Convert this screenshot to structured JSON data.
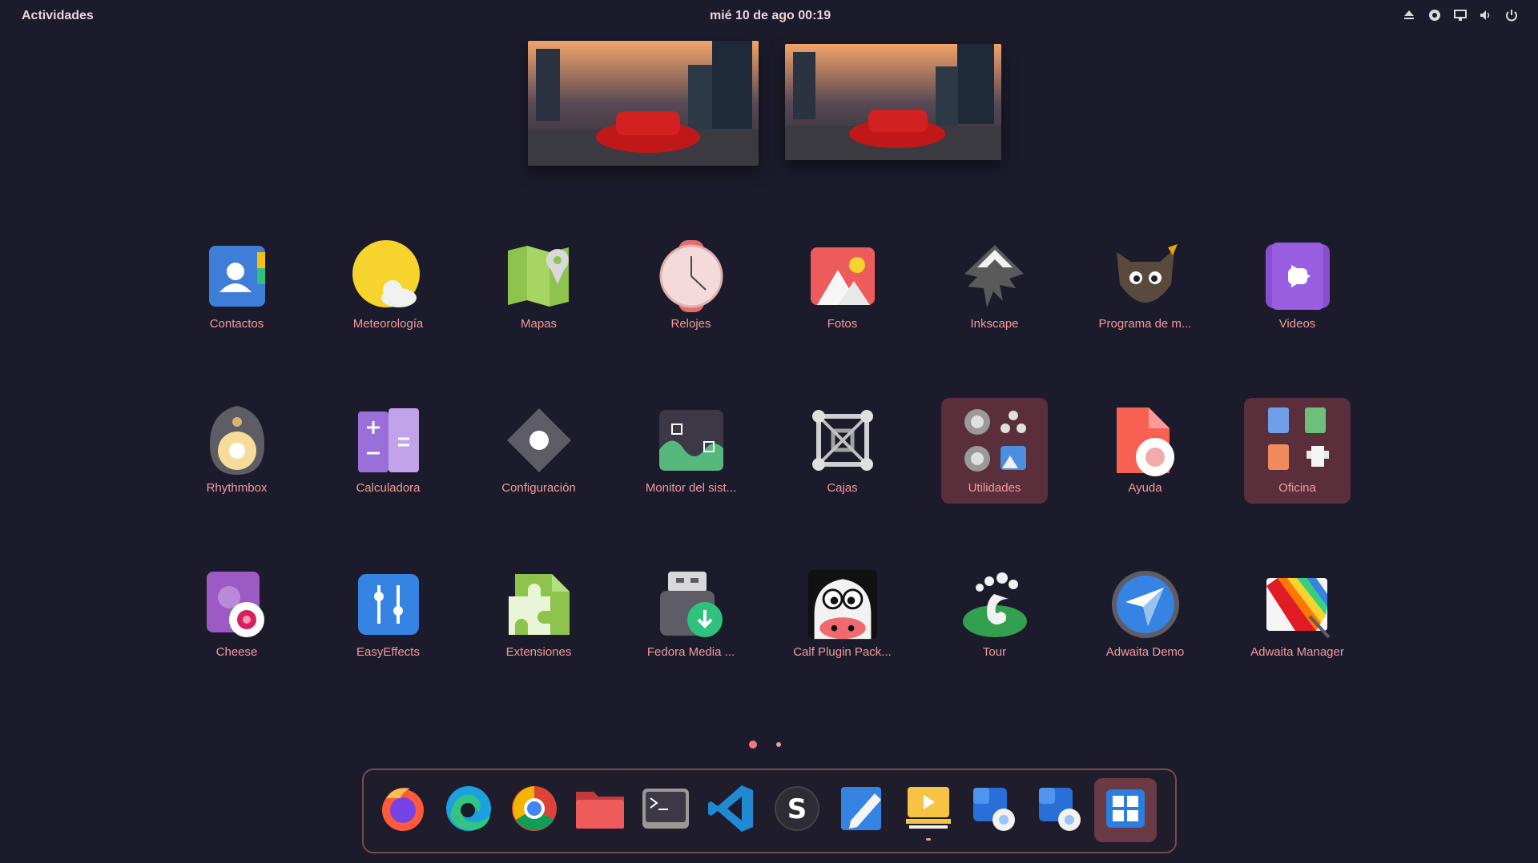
{
  "topbar": {
    "activities": "Actividades",
    "clock": "mié 10 de ago  00:19"
  },
  "tray_icons": [
    "eject-icon",
    "camera-icon",
    "network-icon",
    "volume-icon",
    "power-icon"
  ],
  "apps": [
    {
      "label": "Contactos",
      "icon": "contacts-icon"
    },
    {
      "label": "Meteorología",
      "icon": "weather-icon"
    },
    {
      "label": "Mapas",
      "icon": "maps-icon"
    },
    {
      "label": "Relojes",
      "icon": "clocks-icon"
    },
    {
      "label": "Fotos",
      "icon": "photos-icon"
    },
    {
      "label": "Inkscape",
      "icon": "inkscape-icon"
    },
    {
      "label": "Programa de m...",
      "icon": "gimp-icon"
    },
    {
      "label": "Videos",
      "icon": "videos-icon"
    },
    {
      "label": "Rhythmbox",
      "icon": "rhythmbox-icon"
    },
    {
      "label": "Calculadora",
      "icon": "calculator-icon"
    },
    {
      "label": "Configuración",
      "icon": "settings-icon"
    },
    {
      "label": "Monitor del sist...",
      "icon": "system-monitor-icon"
    },
    {
      "label": "Cajas",
      "icon": "boxes-icon"
    },
    {
      "label": "Utilidades",
      "icon": "utilities-folder-icon"
    },
    {
      "label": "Ayuda",
      "icon": "help-icon"
    },
    {
      "label": "Oficina",
      "icon": "office-folder-icon"
    },
    {
      "label": "Cheese",
      "icon": "cheese-icon"
    },
    {
      "label": "EasyEffects",
      "icon": "easyeffects-icon"
    },
    {
      "label": "Extensiones",
      "icon": "extensions-icon"
    },
    {
      "label": "Fedora Media ...",
      "icon": "fedora-media-writer-icon"
    },
    {
      "label": "Calf Plugin Pack...",
      "icon": "calf-icon"
    },
    {
      "label": "Tour",
      "icon": "tour-icon"
    },
    {
      "label": "Adwaita Demo",
      "icon": "adwaita-demo-icon"
    },
    {
      "label": "Adwaita Manager",
      "icon": "adwaita-manager-icon"
    }
  ],
  "dock": [
    "firefox-icon",
    "edge-icon",
    "chrome-icon",
    "files-icon",
    "terminal-icon",
    "vscode-icon",
    "simplenote-icon",
    "text-editor-icon",
    "slides-icon",
    "remote-desktop-icon",
    "remote-desktop-2-icon",
    "windows-icon"
  ],
  "colors": {
    "background": "#1c1b2b",
    "label": "#f29b9b",
    "folder": "#5a2e3b",
    "accent": "#f17a7a"
  },
  "pages": {
    "total": 2,
    "current": 1
  }
}
